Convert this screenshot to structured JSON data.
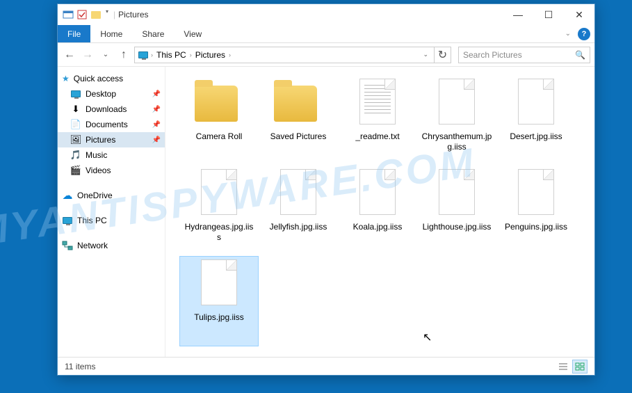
{
  "titlebar": {
    "title": "Pictures",
    "sep": "|"
  },
  "ribbon": {
    "file": "File",
    "home": "Home",
    "share": "Share",
    "view": "View"
  },
  "breadcrumb": {
    "c0_icon": "monitor",
    "c1": "This PC",
    "c2": "Pictures"
  },
  "search": {
    "placeholder": "Search Pictures"
  },
  "sidebar": {
    "quick_access": "Quick access",
    "items": [
      {
        "label": "Desktop",
        "icon": "monitor",
        "pinned": true
      },
      {
        "label": "Downloads",
        "icon": "down",
        "pinned": true
      },
      {
        "label": "Documents",
        "icon": "doc",
        "pinned": true
      },
      {
        "label": "Pictures",
        "icon": "pic",
        "pinned": true,
        "selected": true
      },
      {
        "label": "Music",
        "icon": "music",
        "pinned": false
      },
      {
        "label": "Videos",
        "icon": "video",
        "pinned": false
      }
    ],
    "onedrive": "OneDrive",
    "thispc": "This PC",
    "network": "Network"
  },
  "files": [
    {
      "name": "Camera Roll",
      "type": "folder"
    },
    {
      "name": "Saved Pictures",
      "type": "folder"
    },
    {
      "name": "_readme.txt",
      "type": "text"
    },
    {
      "name": "Chrysanthemum.jpg.iiss",
      "type": "file"
    },
    {
      "name": "Desert.jpg.iiss",
      "type": "file"
    },
    {
      "name": "Hydrangeas.jpg.iiss",
      "type": "file"
    },
    {
      "name": "Jellyfish.jpg.iiss",
      "type": "file"
    },
    {
      "name": "Koala.jpg.iiss",
      "type": "file"
    },
    {
      "name": "Lighthouse.jpg.iiss",
      "type": "file"
    },
    {
      "name": "Penguins.jpg.iiss",
      "type": "file"
    },
    {
      "name": "Tulips.jpg.iiss",
      "type": "file",
      "selected": true
    }
  ],
  "status": {
    "count": "11 items"
  },
  "watermark": "MYANTISPYWARE.COM"
}
